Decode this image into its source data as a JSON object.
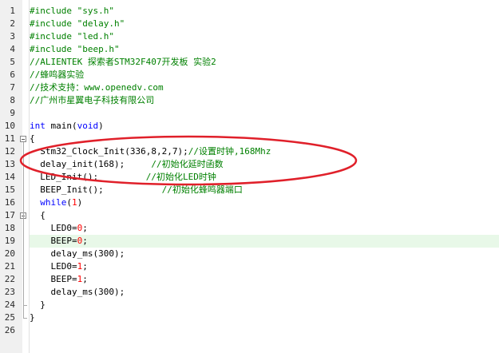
{
  "editor": {
    "colors": {
      "preprocessor": "#008000",
      "comment": "#008000",
      "keyword": "#0000ff",
      "string": "#808080",
      "number": "#ff0000",
      "highlight": "#e8f8e8",
      "annotation": "#e0202a"
    },
    "highlighted_line": 19,
    "annotation": "red-ellipse-around-clock-init",
    "lines": [
      {
        "n": "1",
        "tokens": [
          {
            "t": "#include ",
            "c": "pre"
          },
          {
            "t": "\"sys.h\"",
            "c": "pre"
          }
        ]
      },
      {
        "n": "2",
        "tokens": [
          {
            "t": "#include ",
            "c": "pre"
          },
          {
            "t": "\"delay.h\"",
            "c": "pre"
          }
        ]
      },
      {
        "n": "3",
        "tokens": [
          {
            "t": "#include ",
            "c": "pre"
          },
          {
            "t": "\"led.h\"",
            "c": "pre"
          }
        ]
      },
      {
        "n": "4",
        "tokens": [
          {
            "t": "#include ",
            "c": "pre"
          },
          {
            "t": "\"beep.h\"",
            "c": "pre"
          }
        ]
      },
      {
        "n": "5",
        "tokens": [
          {
            "t": "//ALIENTEK 探索者STM32F407开发板 实验2",
            "c": "cm"
          }
        ]
      },
      {
        "n": "6",
        "tokens": [
          {
            "t": "//蜂鸣器实验",
            "c": "cm"
          }
        ]
      },
      {
        "n": "7",
        "tokens": [
          {
            "t": "//技术支持：www.openedv.com",
            "c": "cm"
          }
        ]
      },
      {
        "n": "8",
        "tokens": [
          {
            "t": "//广州市星翼电子科技有限公司",
            "c": "cm"
          }
        ]
      },
      {
        "n": "9",
        "tokens": []
      },
      {
        "n": "10",
        "tokens": [
          {
            "t": "int",
            "c": "kw"
          },
          {
            "t": " main(",
            "c": "tx"
          },
          {
            "t": "void",
            "c": "kw"
          },
          {
            "t": ")",
            "c": "tx"
          }
        ]
      },
      {
        "n": "11",
        "tokens": [
          {
            "t": "{",
            "c": "tx"
          }
        ],
        "fold": "open"
      },
      {
        "n": "12",
        "tokens": [
          {
            "t": "  Stm32_Clock_Init(",
            "c": "tx"
          },
          {
            "t": "336",
            "c": "tx"
          },
          {
            "t": ",",
            "c": "tx"
          },
          {
            "t": "8",
            "c": "tx"
          },
          {
            "t": ",",
            "c": "tx"
          },
          {
            "t": "2",
            "c": "tx"
          },
          {
            "t": ",",
            "c": "tx"
          },
          {
            "t": "7",
            "c": "tx"
          },
          {
            "t": ");",
            "c": "tx"
          },
          {
            "t": "//设置时钟,168Mhz",
            "c": "cm"
          }
        ]
      },
      {
        "n": "13",
        "tokens": [
          {
            "t": "  delay_init(",
            "c": "tx"
          },
          {
            "t": "168",
            "c": "tx"
          },
          {
            "t": ");     ",
            "c": "tx"
          },
          {
            "t": "//初始化延时函数",
            "c": "cm"
          }
        ]
      },
      {
        "n": "14",
        "tokens": [
          {
            "t": "  LED_Init();         ",
            "c": "tx"
          },
          {
            "t": "//初始化LED时钟",
            "c": "cm"
          }
        ]
      },
      {
        "n": "15",
        "tokens": [
          {
            "t": "  BEEP_Init();           ",
            "c": "tx"
          },
          {
            "t": "//初始化蜂鸣器端口",
            "c": "cm"
          }
        ]
      },
      {
        "n": "16",
        "tokens": [
          {
            "t": "  ",
            "c": "tx"
          },
          {
            "t": "while",
            "c": "kw"
          },
          {
            "t": "(",
            "c": "tx"
          },
          {
            "t": "1",
            "c": "num"
          },
          {
            "t": ")",
            "c": "tx"
          }
        ]
      },
      {
        "n": "17",
        "tokens": [
          {
            "t": "  {",
            "c": "tx"
          }
        ],
        "fold": "open"
      },
      {
        "n": "18",
        "tokens": [
          {
            "t": "    LED0=",
            "c": "tx"
          },
          {
            "t": "0",
            "c": "num"
          },
          {
            "t": ";",
            "c": "tx"
          }
        ]
      },
      {
        "n": "19",
        "tokens": [
          {
            "t": "    BEEP=",
            "c": "tx"
          },
          {
            "t": "0",
            "c": "num"
          },
          {
            "t": ";",
            "c": "tx"
          }
        ]
      },
      {
        "n": "20",
        "tokens": [
          {
            "t": "    delay_ms(",
            "c": "tx"
          },
          {
            "t": "300",
            "c": "tx"
          },
          {
            "t": ");",
            "c": "tx"
          }
        ]
      },
      {
        "n": "21",
        "tokens": [
          {
            "t": "    LED0=",
            "c": "tx"
          },
          {
            "t": "1",
            "c": "num"
          },
          {
            "t": ";",
            "c": "tx"
          }
        ]
      },
      {
        "n": "22",
        "tokens": [
          {
            "t": "    BEEP=",
            "c": "tx"
          },
          {
            "t": "1",
            "c": "num"
          },
          {
            "t": ";",
            "c": "tx"
          }
        ]
      },
      {
        "n": "23",
        "tokens": [
          {
            "t": "    delay_ms(",
            "c": "tx"
          },
          {
            "t": "300",
            "c": "tx"
          },
          {
            "t": ");",
            "c": "tx"
          }
        ]
      },
      {
        "n": "24",
        "tokens": [
          {
            "t": "  }",
            "c": "tx"
          }
        ],
        "fold": "end"
      },
      {
        "n": "25",
        "tokens": [
          {
            "t": "}",
            "c": "tx"
          }
        ],
        "fold": "end"
      },
      {
        "n": "26",
        "tokens": []
      }
    ]
  }
}
